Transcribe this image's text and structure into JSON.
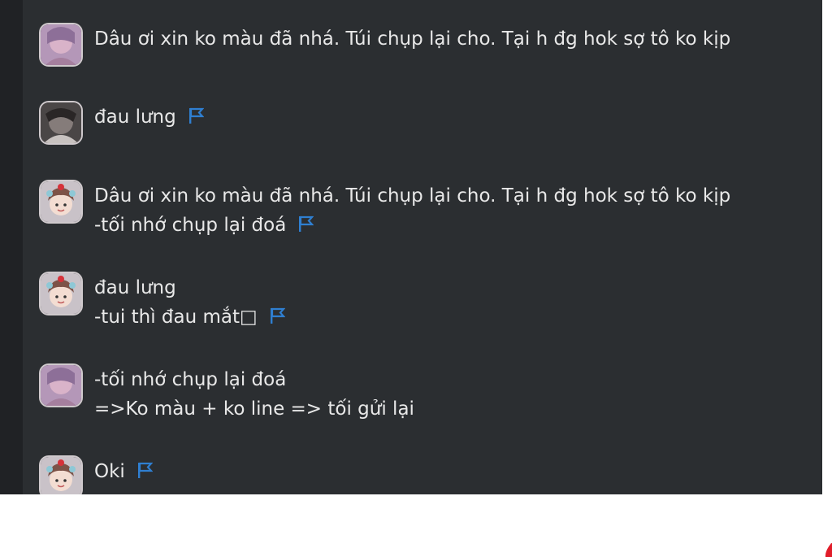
{
  "messages": [
    {
      "avatar": "avatar-pink-purple",
      "lines": [
        "Dâu ơi xin ko màu đã nhá. Túi chụp lại cho. Tại h đg hok sợ tô ko kịp"
      ],
      "flag": false
    },
    {
      "avatar": "avatar-dark-gray",
      "lines": [
        "đau lưng"
      ],
      "flag": true
    },
    {
      "avatar": "avatar-chibi-girl",
      "lines": [
        "Dâu ơi xin ko màu đã nhá. Túi chụp lại cho. Tại h đg hok sợ tô ko kịp",
        "-tối nhớ chụp lại đoá"
      ],
      "flag": true
    },
    {
      "avatar": "avatar-chibi-girl",
      "lines": [
        "đau lưng",
        "-tui thì đau mắt□"
      ],
      "flag": true
    },
    {
      "avatar": "avatar-pink-purple",
      "lines": [
        "-tối nhớ chụp lại đoá",
        "=>Ko màu + ko line => tối gửi lại"
      ],
      "flag": false
    },
    {
      "avatar": "avatar-chibi-girl",
      "lines": [
        "Oki"
      ],
      "flag": true
    }
  ],
  "colors": {
    "panel_bg": "#2b2e31",
    "text": "#e8e8e8",
    "flag": "#2f7fd1",
    "accent_red": "#e11d2a"
  }
}
